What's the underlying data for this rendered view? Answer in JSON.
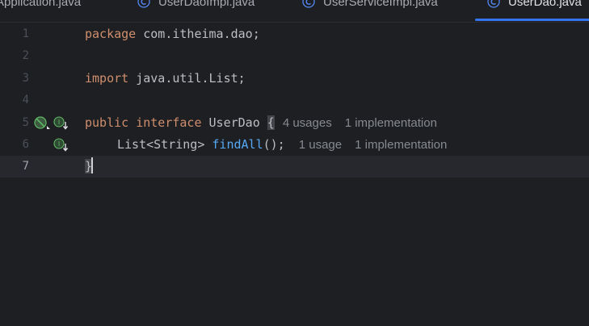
{
  "tabs": [
    {
      "label": "Application.java",
      "icon": "none",
      "active": false
    },
    {
      "label": "UserDaoImpl.java",
      "icon": "class-icon",
      "active": false
    },
    {
      "label": "UserServiceImpl.java",
      "icon": "class-icon",
      "active": false
    },
    {
      "label": "UserDao.java",
      "icon": "class-icon",
      "active": true
    }
  ],
  "colors": {
    "background": "#1e1f22",
    "keyword": "#cf8e6d",
    "method": "#56a8f5",
    "text": "#bcbec4",
    "hint": "#868a91",
    "active_tab_underline": "#3574f0",
    "current_line": "#26282e"
  },
  "editor": {
    "line_numbers": [
      "1",
      "2",
      "3",
      "4",
      "5",
      "6",
      "7"
    ],
    "current_line": "7",
    "line1": {
      "kw": "package",
      "rest": " com.itheima.dao;"
    },
    "line3": {
      "kw": "import",
      "rest": " java.util.List;"
    },
    "line5": {
      "kw1": "public",
      "kw2": "interface",
      "name": " UserDao ",
      "brace": "{",
      "usages": "4 usages",
      "impl": "1 implementation"
    },
    "line6": {
      "type": "List<String> ",
      "method": "findAll",
      "rest": "();",
      "usages": "1 usage",
      "impl": "1 implementation"
    },
    "line7": {
      "brace": "}"
    }
  },
  "gutter_icons": {
    "line5": [
      "implemented-interface-icon",
      "navigate-implementation-icon"
    ],
    "line6": [
      "navigate-implementation-icon"
    ]
  }
}
